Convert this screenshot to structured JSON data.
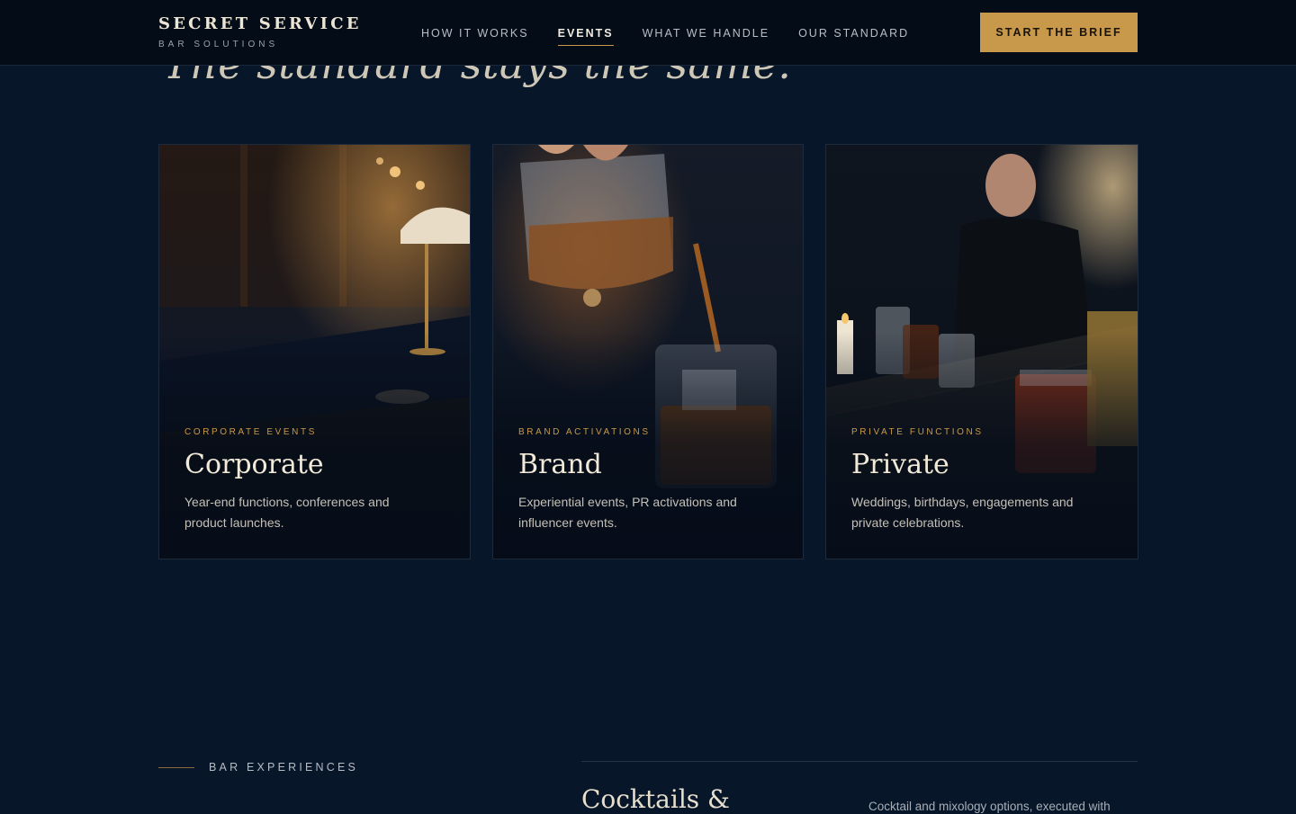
{
  "brand": {
    "name": "SECRET SERVICE",
    "tagline": "BAR SOLUTIONS"
  },
  "nav": {
    "items": [
      {
        "label": "HOW IT WORKS"
      },
      {
        "label": "EVENTS",
        "active": true
      },
      {
        "label": "WHAT WE HANDLE"
      },
      {
        "label": "OUR STANDARD"
      }
    ],
    "cta_label": "START THE BRIEF"
  },
  "section": {
    "heading": "The standard stays the same."
  },
  "cards": [
    {
      "eyebrow": "CORPORATE EVENTS",
      "title": "Corporate",
      "description": "Year-end functions, conferences and product launches."
    },
    {
      "eyebrow": "BRAND ACTIVATIONS",
      "title": "Brand",
      "description": "Experiential events, PR activations and influencer events."
    },
    {
      "eyebrow": "PRIVATE FUNCTIONS",
      "title": "Private",
      "description": "Weddings, birthdays, engagements and private celebrations."
    }
  ],
  "bar_experiences": {
    "label": "BAR EXPERIENCES",
    "title": "Cocktails &",
    "description": "Cocktail and mixology options, executed with"
  },
  "colors": {
    "accent": "#c8994a",
    "background": "#071629",
    "header": "#040c17"
  }
}
